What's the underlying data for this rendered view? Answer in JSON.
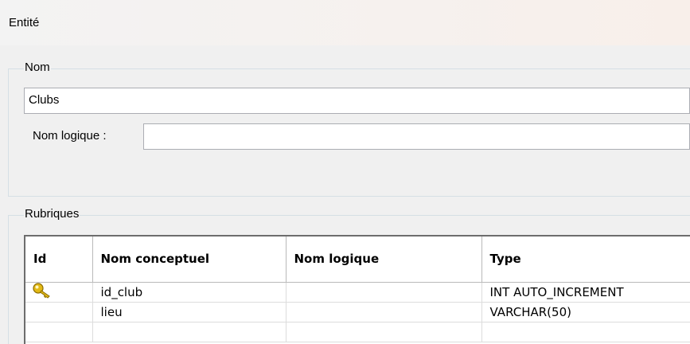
{
  "header": {
    "title": "Entité"
  },
  "nom_group": {
    "legend": "Nom",
    "name_value": "Clubs",
    "logical_label": "Nom logique :",
    "logical_value": ""
  },
  "rubriques_group": {
    "legend": "Rubriques",
    "columns": [
      "Id",
      "Nom conceptuel",
      "Nom logique",
      "Type"
    ],
    "rows": [
      {
        "id_icon": "key-icon",
        "conceptual": "id_club",
        "logical": "",
        "type": "INT AUTO_INCREMENT"
      },
      {
        "id_icon": "",
        "conceptual": "lieu",
        "logical": "",
        "type": "VARCHAR(50)"
      },
      {
        "id_icon": "",
        "conceptual": "",
        "logical": "",
        "type": ""
      }
    ]
  },
  "colors": {
    "key_gold": "#e2b915",
    "grid_border": "#6d6d6d"
  }
}
